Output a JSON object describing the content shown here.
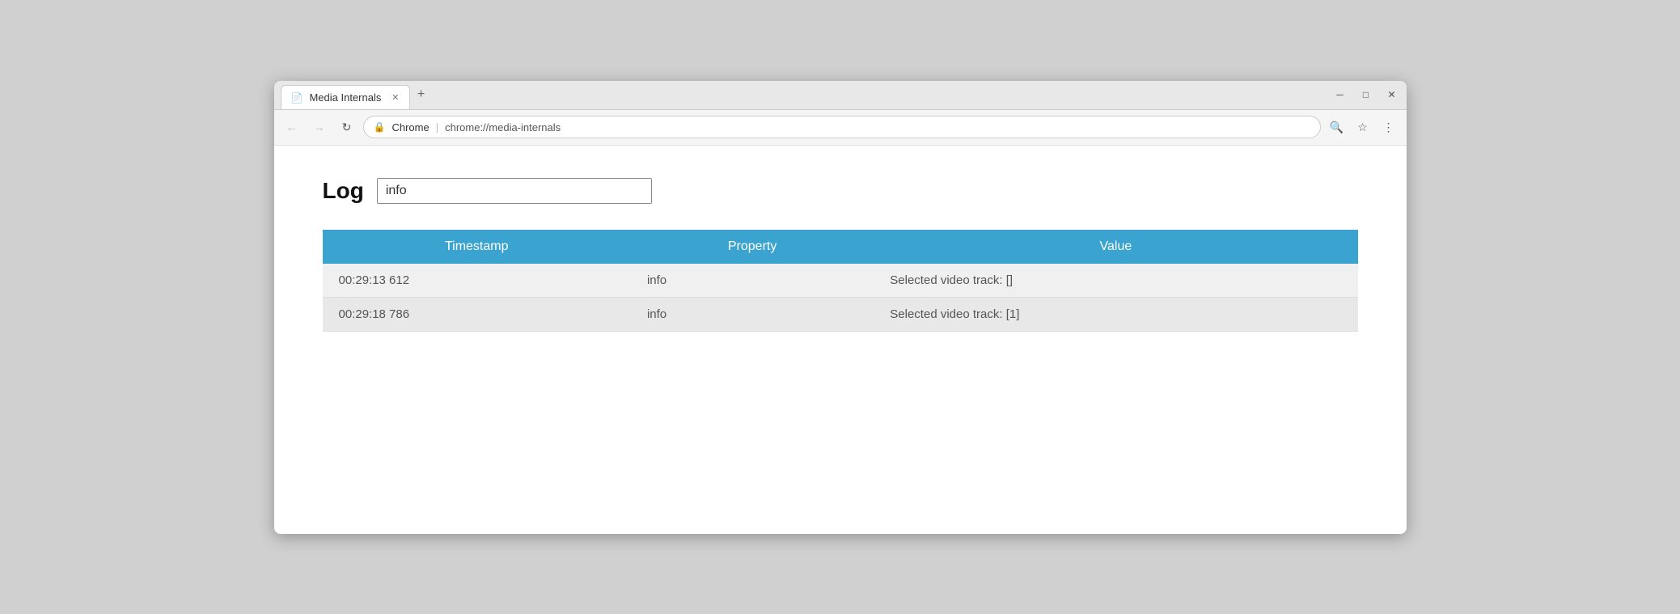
{
  "window": {
    "title": "Media Internals",
    "close_label": "✕",
    "maximize_label": "□",
    "minimize_label": "─"
  },
  "tab": {
    "label": "Media Internals",
    "icon": "📄",
    "close": "✕"
  },
  "new_tab_btn": "+",
  "addressbar": {
    "back_icon": "←",
    "forward_icon": "→",
    "reload_icon": "↻",
    "lock_icon": "🔒",
    "site_label": "Chrome",
    "separator": "|",
    "url": "chrome://media-internals",
    "search_icon": "🔍",
    "star_icon": "☆",
    "menu_icon": "⋮"
  },
  "page": {
    "log_label": "Log",
    "log_input_value": "info",
    "table": {
      "headers": [
        "Timestamp",
        "Property",
        "Value"
      ],
      "rows": [
        {
          "timestamp": "00:29:13 612",
          "property": "info",
          "value": "Selected video track: []"
        },
        {
          "timestamp": "00:29:18 786",
          "property": "info",
          "value": "Selected video track: [1]"
        }
      ]
    }
  }
}
